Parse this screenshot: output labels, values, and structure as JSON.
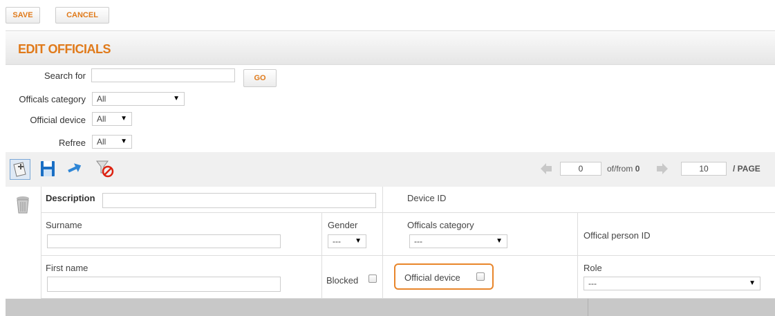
{
  "top_buttons": {
    "save": "SAVE",
    "cancel": "CANCEL"
  },
  "title": "EDIT OFFICIALS",
  "filters": {
    "search_label": "Search for",
    "search_value": "",
    "go_label": "GO",
    "category_label": "Officals category",
    "category_value": "All",
    "device_label": "Official device",
    "device_value": "All",
    "refree_label": "Refree",
    "refree_value": "All"
  },
  "toolbar": {
    "icons": [
      "new-record-icon",
      "save-icon",
      "refresh-icon",
      "clear-filter-icon"
    ]
  },
  "pagination": {
    "current": "0",
    "of_from_label": "of/from",
    "total": "0",
    "page_size": "10",
    "page_label": "/ PAGE"
  },
  "form": {
    "description_label": "Description",
    "description_value": "",
    "device_id_label": "Device ID",
    "surname_label": "Surname",
    "gender_label": "Gender",
    "gender_value": "---",
    "category_label": "Officals category",
    "category_value": "---",
    "person_id_label": "Offical person ID",
    "first_name_label": "First name",
    "blocked_label": "Blocked",
    "official_device_label": "Official device",
    "role_label": "Role",
    "role_value": "---"
  },
  "colors": {
    "accent": "#e07a1a",
    "highlight_border": "#e8852a"
  }
}
